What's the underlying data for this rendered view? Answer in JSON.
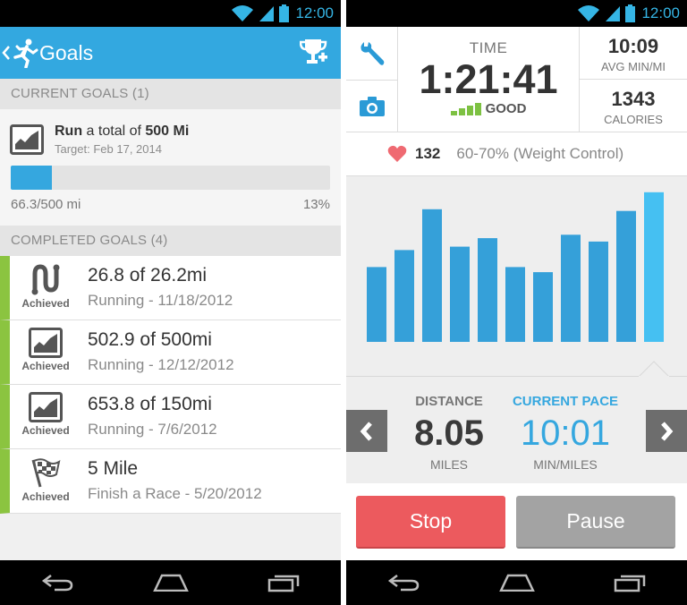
{
  "status_bar": {
    "time": "12:00"
  },
  "goals_screen": {
    "title": "Goals",
    "current_header": "CURRENT GOALS (1)",
    "current_goal": {
      "title_prefix": "Run",
      "title_middle": " a total of ",
      "title_bold": "500 Mi",
      "target": "Target: Feb 17, 2014",
      "progress_fraction": 0.13,
      "progress_text": "66.3/500 mi",
      "percent": "13%"
    },
    "completed_header": "COMPLETED GOALS (4)",
    "completed": [
      {
        "badge": "Achieved",
        "icon": "route-icon",
        "title": "26.8 of 26.2mi",
        "subtitle": "Running - 11/18/2012"
      },
      {
        "badge": "Achieved",
        "icon": "chart-icon",
        "title": "502.9 of 500mi",
        "subtitle": "Running - 12/12/2012"
      },
      {
        "badge": "Achieved",
        "icon": "chart-icon",
        "title": "653.8 of 150mi",
        "subtitle": "Running - 7/6/2012"
      },
      {
        "badge": "Achieved",
        "icon": "checkered-flag-icon",
        "title": "5 Mile",
        "subtitle": "Finish a Race - 5/20/2012"
      }
    ]
  },
  "run_screen": {
    "time_label": "TIME",
    "time_value": "1:21:41",
    "signal_label": "GOOD",
    "avg_pace_value": "10:09",
    "avg_pace_label": "AVG MIN/MI",
    "calories_value": "1343",
    "calories_label": "CALORIES",
    "heart_rate": "132",
    "heart_zone": "60-70% (Weight Control)",
    "chart_data": {
      "type": "bar",
      "values": [
        0.44,
        0.54,
        0.78,
        0.56,
        0.61,
        0.44,
        0.41,
        0.63,
        0.59,
        0.77,
        0.88
      ],
      "highlight_last": true,
      "colors": {
        "bar": "#35a0d9",
        "highlight": "#45c0f2"
      }
    },
    "distance_label": "DISTANCE",
    "distance_value": "8.05",
    "distance_unit": "MILES",
    "current_pace_label": "CURRENT PACE",
    "current_pace_value": "10:01",
    "current_pace_unit": "MIN/MILES",
    "stop_label": "Stop",
    "pause_label": "Pause"
  },
  "colors": {
    "accent_blue": "#33a8e0",
    "achieved_green": "#8bc440",
    "stop_red": "#ec5a5e",
    "pause_gray": "#a3a3a3"
  }
}
